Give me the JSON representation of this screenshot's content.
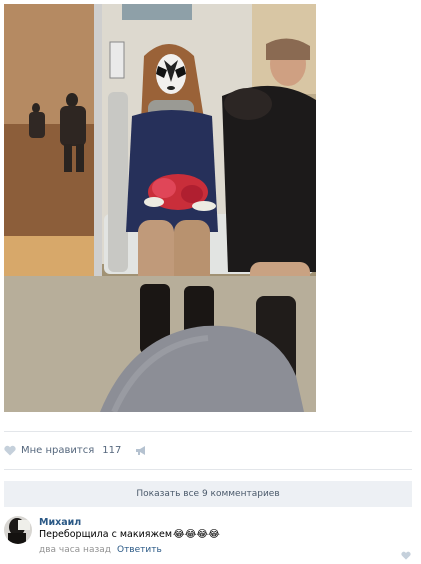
{
  "post": {
    "photo_icon": "photo-metro-passenger",
    "likes": {
      "label": "Мне нравится",
      "count": "117",
      "icon": "heart-icon"
    },
    "share_icon": "megaphone-icon"
  },
  "comments": {
    "show_all_label": "Показать все 9 комментариев",
    "items": [
      {
        "author": "Михаил",
        "text": "Переборщила с макияжем",
        "emojis": "😂😂😂😂",
        "time": "два часа назад",
        "reply_label": "Ответить"
      }
    ]
  },
  "colors": {
    "link": "#2a5885",
    "muted": "#939393",
    "like_icon": "#c5d0db",
    "bar_bg": "#edf0f4"
  }
}
